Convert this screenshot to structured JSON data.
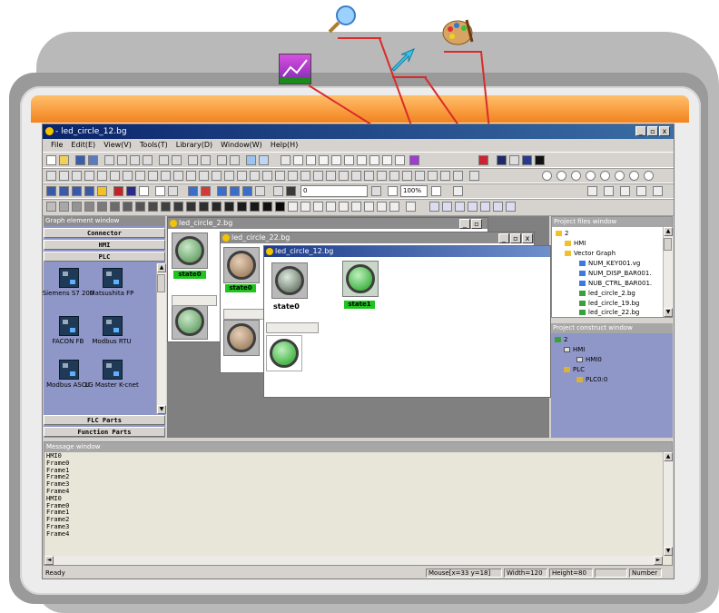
{
  "window": {
    "title": "- led_circle_12.bg",
    "controls": [
      "_",
      "▫",
      "x"
    ]
  },
  "menu": [
    "File",
    "Edit(E)",
    "View(V)",
    "Tools(T)",
    "Library(D)",
    "Window(W)",
    "Help(H)"
  ],
  "toolbar": {
    "line_width_value": "0",
    "zoom_value": "100%"
  },
  "graph_element_window": {
    "title": "Graph element window",
    "categories_top": [
      "Connector",
      "HMI",
      "PLC"
    ],
    "items": [
      {
        "label": "Siemens S7 200",
        "icon": "plc-device-icon"
      },
      {
        "label": "Matsushita FP",
        "icon": "plc-device-icon"
      },
      {
        "label": "FACON FB",
        "icon": "plc-device-icon"
      },
      {
        "label": "Modbus RTU",
        "icon": "plc-device-icon"
      },
      {
        "label": "Modbus ASCII",
        "icon": "plc-device-icon"
      },
      {
        "label": "LG Master K-cnet",
        "icon": "plc-device-icon"
      }
    ],
    "categories_bottom": [
      "FLC Parts",
      "Function Parts"
    ]
  },
  "documents": [
    {
      "title": "led_circle_2.bg",
      "label": "state0"
    },
    {
      "title": "led_circle_22.bg",
      "label": "state0"
    },
    {
      "title": "led_circle_12.bg",
      "labels": [
        "state0",
        "state1"
      ]
    }
  ],
  "project_files": {
    "title": "Project files window",
    "items": [
      "2",
      "HMI",
      "Vector Graph",
      "NUM_KEY001.vg",
      "NUM_DISP_BAR001.",
      "NUB_CTRL_BAR001.",
      "led_circle_2.bg",
      "led_circle_19.bg",
      "led_circle_22.bg"
    ]
  },
  "project_construct": {
    "title": "Project construct window",
    "items": [
      "2",
      "HMI",
      "HMI0",
      "PLC",
      "PLC0:0"
    ]
  },
  "message_window": {
    "title": "Message window",
    "lines": [
      "HMI0",
      "Frame0",
      "Frame1",
      "Frame2",
      "Frame3",
      "Frame4",
      "HMI0",
      "Frame0",
      "Frame1",
      "Frame2",
      "Frame3",
      "Frame4"
    ]
  },
  "status": {
    "ready": "Ready",
    "mouse": "Mouse[x=33 y=18]",
    "width": "Width=120",
    "height": "Height=80",
    "number": "Number"
  },
  "callout_icons": [
    "chart-icon",
    "magnifier-icon",
    "arrow-icon",
    "palette-icon"
  ],
  "colors": {
    "accent_orange": "#f2831e",
    "title_blue": "#0a246a",
    "led_green": "#1fc21f",
    "panel_blue": "#8f96c8"
  }
}
